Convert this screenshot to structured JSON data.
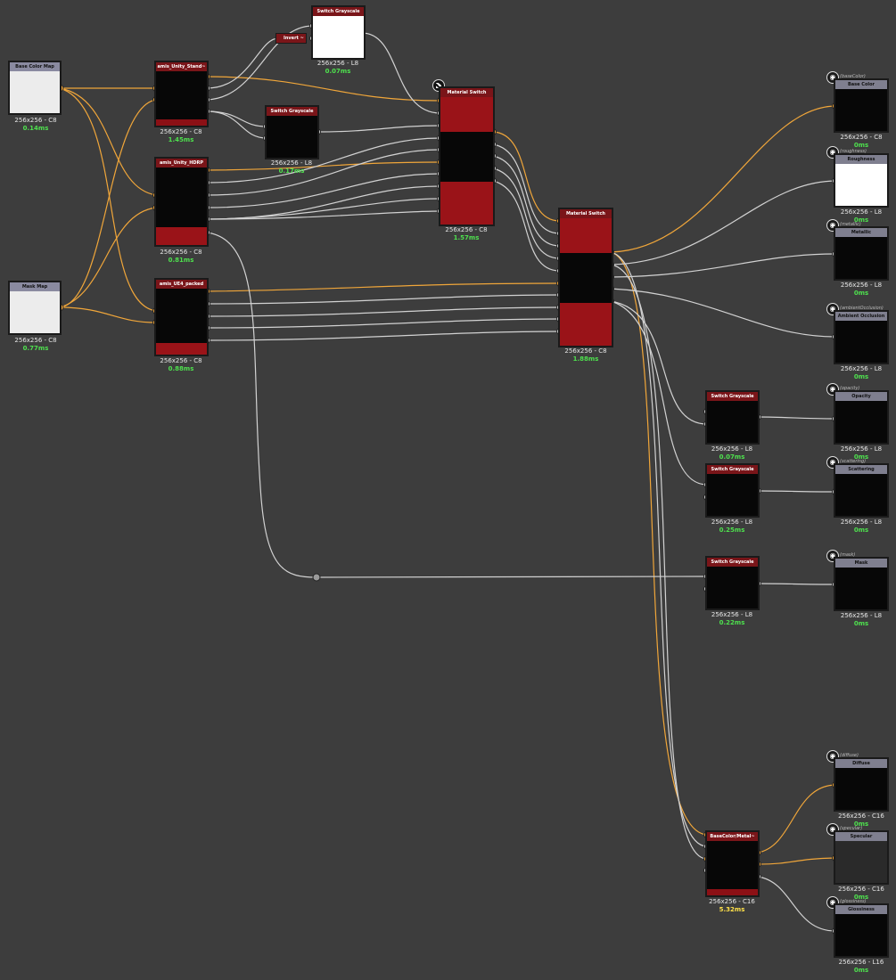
{
  "nodes": {
    "base_color_map": {
      "title": "Base Color Map",
      "info": "256x256 - C8",
      "time": "0.14ms"
    },
    "mask_map": {
      "title": "Mask Map",
      "info": "256x256 - C8",
      "time": "0.77ms"
    },
    "unity_standard": {
      "title": "amis_Unity_Stand~",
      "info": "256x256 - C8",
      "time": "1.45ms"
    },
    "unity_hdrp": {
      "title": "amis_Unity_HDRP",
      "info": "256x256 - C8",
      "time": "0.81ms"
    },
    "ue4_packed": {
      "title": "amis_UE4_packed",
      "info": "256x256 - C8",
      "time": "0.88ms"
    },
    "switch_gray_top": {
      "title": "Switch Grayscale",
      "info": "256x256 - L8",
      "time": "0.07ms"
    },
    "invert": {
      "title": "Invert ~"
    },
    "switch_gray_mid": {
      "title": "Switch Grayscale",
      "info": "256x256 - L8",
      "time": "0.17ms"
    },
    "material_switch_1": {
      "title": "Material Switch",
      "info": "256x256 - C8",
      "time": "1.57ms"
    },
    "material_switch_2": {
      "title": "Material Switch",
      "info": "256x256 - C8",
      "time": "1.88ms"
    },
    "switch_gray_opacity": {
      "title": "Switch Grayscale",
      "info": "256x256 - L8",
      "time": "0.07ms"
    },
    "switch_gray_scatter": {
      "title": "Switch Grayscale",
      "info": "256x256 - L8",
      "time": "0.25ms"
    },
    "switch_gray_mask": {
      "title": "Switch Grayscale",
      "info": "256x256 - L8",
      "time": "0.22ms"
    },
    "basecolor_metal": {
      "title": "BaseColor/Metal~",
      "info": "256x256 - C16",
      "time": "5.32ms"
    }
  },
  "outputs": [
    {
      "id": "(baseColor)",
      "title": "Base Color",
      "info": "256x256 - C8",
      "time": "0ms"
    },
    {
      "id": "(roughness)",
      "title": "Roughness",
      "info": "256x256 - L8",
      "time": "0ms"
    },
    {
      "id": "(metallic)",
      "title": "Metallic",
      "info": "256x256 - L8",
      "time": "0ms"
    },
    {
      "id": "(ambientOcclusion)",
      "title": "Ambient Occlusion",
      "info": "256x256 - L8",
      "time": "0ms"
    },
    {
      "id": "(opacity)",
      "title": "Opacity",
      "info": "256x256 - L8",
      "time": "0ms"
    },
    {
      "id": "(scattering)",
      "title": "Scattering",
      "info": "256x256 - L8",
      "time": "0ms"
    },
    {
      "id": "(mask)",
      "title": "Mask",
      "info": "256x256 - L8",
      "time": "0ms"
    },
    {
      "id": "(diffuse)",
      "title": "Diffuse",
      "info": "256x256 - C16",
      "time": "0ms"
    },
    {
      "id": "(specular)",
      "title": "Specular",
      "info": "256x256 - C16",
      "time": "0ms"
    },
    {
      "id": "(glossiness)",
      "title": "Glossiness",
      "info": "256x256 - L16",
      "time": "0ms"
    }
  ],
  "colors": {
    "canvas": "#3d3d3d",
    "node_header": "#7a1519",
    "node_body": "#070707",
    "node_red": "#9a1318",
    "color_wire": "#f0a63a",
    "gray_wire": "#d2d2d2",
    "time_ok": "#4ee04e",
    "time_slow": "#ffe14a"
  }
}
